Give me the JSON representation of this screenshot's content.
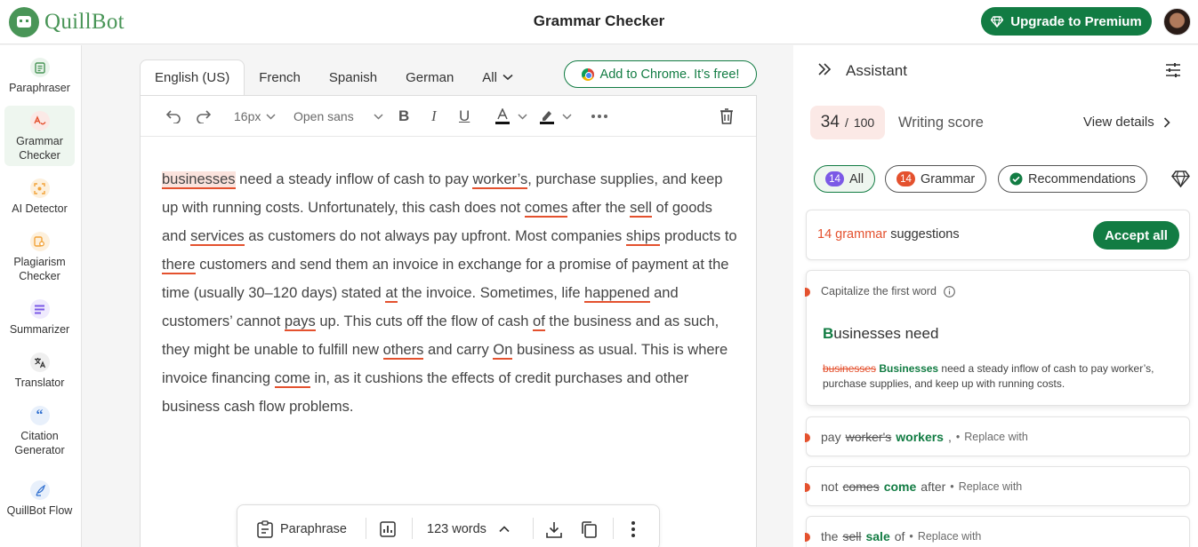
{
  "header": {
    "brand": "QuillBot",
    "title": "Grammar Checker",
    "upgrade_label": "Upgrade to Premium"
  },
  "sidebar": {
    "items": [
      {
        "label": "Paraphraser",
        "icon": "paraphraser-icon",
        "color": "#499557"
      },
      {
        "label": "Grammar Checker",
        "icon": "grammar-checker-icon",
        "color": "#e4512e",
        "active": true
      },
      {
        "label": "AI Detector",
        "icon": "ai-detector-icon",
        "color": "#f2a33a"
      },
      {
        "label": "Plagiarism Checker",
        "icon": "plagiarism-checker-icon",
        "color": "#f2a33a"
      },
      {
        "label": "Summarizer",
        "icon": "summarizer-icon",
        "color": "#7b59e6"
      },
      {
        "label": "Translator",
        "icon": "translator-icon",
        "color": "#333333"
      },
      {
        "label": "Citation Generator",
        "icon": "citation-icon",
        "color": "#2f6fd0"
      },
      {
        "label": "QuillBot Flow",
        "icon": "flow-icon",
        "color": "#2f6fd0"
      }
    ]
  },
  "editor": {
    "tabs": [
      "English (US)",
      "French",
      "Spanish",
      "German",
      "All"
    ],
    "chrome_label": "Add to Chrome. It’s free!",
    "font_size": "16px",
    "font_family": "Open sans",
    "segments": [
      {
        "t": "businesses",
        "e": "hl"
      },
      {
        "t": " need a steady inflow of cash to pay "
      },
      {
        "t": "worker’s",
        "e": "u"
      },
      {
        "t": ", purchase supplies, and keep up with running costs. Unfortunately, this cash does not "
      },
      {
        "t": "comes",
        "e": "u"
      },
      {
        "t": " after the "
      },
      {
        "t": "sell",
        "e": "u"
      },
      {
        "t": " of goods and "
      },
      {
        "t": "services",
        "e": "u"
      },
      {
        "t": " as customers do not always pay upfront. Most companies "
      },
      {
        "t": "ships",
        "e": "u"
      },
      {
        "t": " products to "
      },
      {
        "t": "there",
        "e": "u"
      },
      {
        "t": " customers and send them an invoice in exchange for a promise of payment at the time (usually 30–120 days) stated "
      },
      {
        "t": "at",
        "e": "u"
      },
      {
        "t": " the invoice. Sometimes, life "
      },
      {
        "t": "happened",
        "e": "u"
      },
      {
        "t": " and customers’ cannot "
      },
      {
        "t": "pays",
        "e": "u"
      },
      {
        "t": " up. This cuts off the flow of cash "
      },
      {
        "t": "of",
        "e": "u"
      },
      {
        "t": " the business and as such, they might be unable to fulfill new "
      },
      {
        "t": "others",
        "e": "u"
      },
      {
        "t": " and carry "
      },
      {
        "t": "On",
        "e": "u"
      },
      {
        "t": " business as usual. This is where invoice financing "
      },
      {
        "t": "come",
        "e": "u"
      },
      {
        "t": " in, as it cushions the effects of credit purchases and other business cash flow problems."
      }
    ],
    "bottom": {
      "paraphrase_label": "Paraphrase",
      "word_count": "123 words"
    }
  },
  "assistant": {
    "title": "Assistant",
    "score": "34",
    "score_sep": "/",
    "score_max": "100",
    "score_label": "Writing score",
    "view_details": "View details",
    "chips": {
      "all_count": "14",
      "all_label": "All",
      "grammar_count": "14",
      "grammar_label": "Grammar",
      "rec_label": "Recommendations"
    },
    "summary": {
      "count_text": "14 grammar",
      "rest": "suggestions",
      "accept_label": "Accept all"
    },
    "main_card": {
      "title": "Capitalize the first word",
      "preview_cap": "B",
      "preview_rest": "usinesses need",
      "old": "businesses",
      "new": "Businesses",
      "context": " need a steady inflow of cash to pay worker’s, purchase supplies, and keep up with running costs."
    },
    "suggestions": [
      {
        "before": "pay",
        "old": "worker's",
        "new": "workers",
        "after": ",",
        "action": "Replace with"
      },
      {
        "before": "not",
        "old": "comes",
        "new": "come",
        "after": "after",
        "action": "Replace with"
      },
      {
        "before": "the",
        "old": "sell",
        "new": "sale",
        "after": "of",
        "action": "Replace with"
      }
    ]
  },
  "colors": {
    "brand": "#127c43",
    "error": "#e4512e",
    "badge_all": "#7b59e6"
  }
}
